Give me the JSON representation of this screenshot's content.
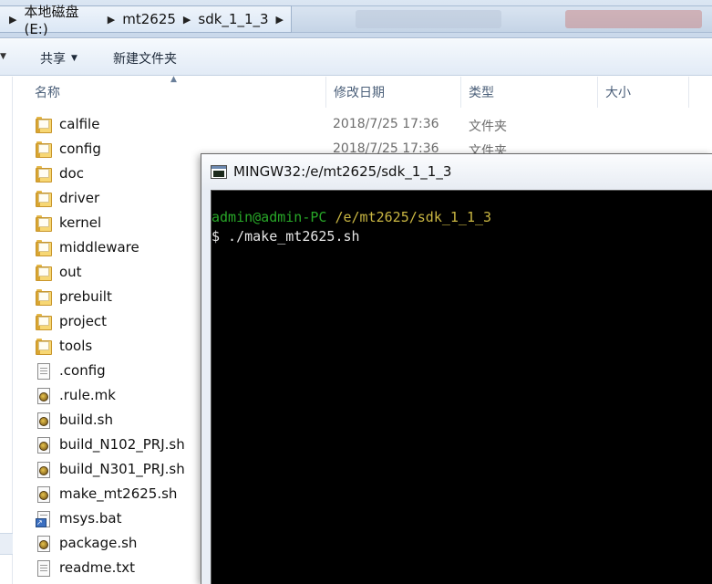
{
  "address": {
    "crumbs": [
      "本地磁盘 (E:)",
      "mt2625",
      "sdk_1_1_3"
    ]
  },
  "toolbar": {
    "share_label": "共享",
    "new_folder_label": "新建文件夹"
  },
  "columns": {
    "name": "名称",
    "modified": "修改日期",
    "type": "类型",
    "size": "大小"
  },
  "files": [
    {
      "name": "calfile",
      "kind": "folder",
      "date": "2018/7/25 17:36",
      "type": "文件夹"
    },
    {
      "name": "config",
      "kind": "folder",
      "date": "2018/7/25 17:36",
      "type": "文件夹"
    },
    {
      "name": "doc",
      "kind": "folder",
      "date": "",
      "type": ""
    },
    {
      "name": "driver",
      "kind": "folder",
      "date": "",
      "type": ""
    },
    {
      "name": "kernel",
      "kind": "folder",
      "date": "",
      "type": ""
    },
    {
      "name": "middleware",
      "kind": "folder",
      "date": "",
      "type": ""
    },
    {
      "name": "out",
      "kind": "folder",
      "date": "",
      "type": ""
    },
    {
      "name": "prebuilt",
      "kind": "folder",
      "date": "",
      "type": ""
    },
    {
      "name": "project",
      "kind": "folder",
      "date": "",
      "type": ""
    },
    {
      "name": "tools",
      "kind": "folder",
      "date": "",
      "type": ""
    },
    {
      "name": ".config",
      "kind": "text",
      "date": "",
      "type": ""
    },
    {
      "name": ".rule.mk",
      "kind": "sh",
      "date": "",
      "type": ""
    },
    {
      "name": "build.sh",
      "kind": "sh",
      "date": "",
      "type": ""
    },
    {
      "name": "build_N102_PRJ.sh",
      "kind": "sh",
      "date": "",
      "type": ""
    },
    {
      "name": "build_N301_PRJ.sh",
      "kind": "sh",
      "date": "",
      "type": ""
    },
    {
      "name": "make_mt2625.sh",
      "kind": "sh",
      "date": "",
      "type": ""
    },
    {
      "name": "msys.bat",
      "kind": "bat",
      "date": "",
      "type": ""
    },
    {
      "name": "package.sh",
      "kind": "sh",
      "date": "",
      "type": ""
    },
    {
      "name": "readme.txt",
      "kind": "text",
      "date": "",
      "type": ""
    }
  ],
  "terminal": {
    "title": "MINGW32:/e/mt2625/sdk_1_1_3",
    "prompt_user": "admin@admin-PC",
    "prompt_path": "/e/mt2625/sdk_1_1_3",
    "command_line": "$ ./make_mt2625.sh"
  },
  "colors": {
    "terminal_bg": "#000000",
    "prompt_user": "#28a828",
    "prompt_path": "#c9b642",
    "terminal_text": "#e6e6e6",
    "folder": "#f7d774"
  }
}
